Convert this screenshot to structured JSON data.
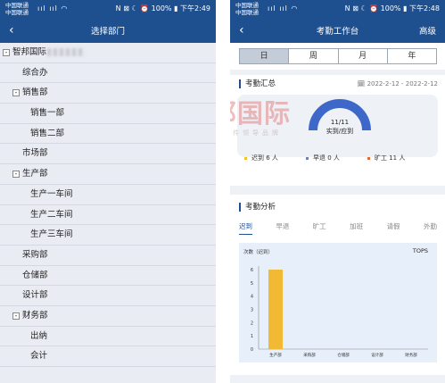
{
  "left": {
    "status": {
      "carrier1": "中国联通",
      "carrier2": "中国联通",
      "right": "N ⊠ ☾ ⏰ 100% ▮ 下午2:49"
    },
    "nav": {
      "back": "‹",
      "title": "选择部门"
    },
    "tree": [
      {
        "label": "智邦国际",
        "toggle": "-",
        "level": 0,
        "has_blur": true
      },
      {
        "label": "综合办",
        "toggle": "",
        "level": 1
      },
      {
        "label": "销售部",
        "toggle": "-",
        "level": 1
      },
      {
        "label": "销售一部",
        "toggle": "",
        "level": 2
      },
      {
        "label": "销售二部",
        "toggle": "",
        "level": 2
      },
      {
        "label": "市场部",
        "toggle": "",
        "level": 1
      },
      {
        "label": "生产部",
        "toggle": "-",
        "level": 1
      },
      {
        "label": "生产一车间",
        "toggle": "",
        "level": 2
      },
      {
        "label": "生产二车间",
        "toggle": "",
        "level": 2
      },
      {
        "label": "生产三车间",
        "toggle": "",
        "level": 2
      },
      {
        "label": "采购部",
        "toggle": "",
        "level": 1
      },
      {
        "label": "仓储部",
        "toggle": "",
        "level": 1
      },
      {
        "label": "设计部",
        "toggle": "",
        "level": 1
      },
      {
        "label": "财务部",
        "toggle": "-",
        "level": 1
      },
      {
        "label": "出纳",
        "toggle": "",
        "level": 2
      },
      {
        "label": "会计",
        "toggle": "",
        "level": 2
      }
    ]
  },
  "right": {
    "status": {
      "carrier1": "中国联通",
      "carrier2": "中国联通",
      "right": "N ⊠ ☾ ⏰ 100% ▮ 下午2:48"
    },
    "nav": {
      "back": "‹",
      "title": "考勤工作台",
      "action": "高级"
    },
    "segments": [
      "日",
      "周",
      "月",
      "年"
    ],
    "active_segment": 0,
    "summary": {
      "title": "考勤汇总",
      "date_range": "🗓 2022-2-12 - 2022-2-12",
      "gauge_value": "11/11",
      "gauge_label": "实到/应到",
      "stats": [
        {
          "label": "迟到 6 人",
          "color": "#f1c232"
        },
        {
          "label": "早退 0 人",
          "color": "#6b7fc4"
        },
        {
          "label": "旷工 11 人",
          "color": "#e06a3c"
        }
      ]
    },
    "analysis": {
      "title": "考勤分析",
      "tabs": [
        "迟到",
        "早退",
        "旷工",
        "加班",
        "请假",
        "外勤"
      ],
      "active_tab": 0
    }
  },
  "watermark": {
    "text": "智邦国际",
    "subtext": "企业管理软件领导品牌"
  },
  "chart_data": {
    "type": "bar",
    "title": "TOPS",
    "ylabel": "次数（迟到）",
    "categories": [
      "生产部",
      "采购部",
      "仓储部",
      "设计部",
      "财务部"
    ],
    "series": [
      {
        "values": [
          6,
          0,
          0,
          0,
          0
        ]
      }
    ],
    "ylim": [
      0,
      6
    ],
    "yticks": [
      0,
      1,
      2,
      3,
      4,
      5,
      6
    ],
    "bar_color": "#f2b935",
    "grid": false
  }
}
